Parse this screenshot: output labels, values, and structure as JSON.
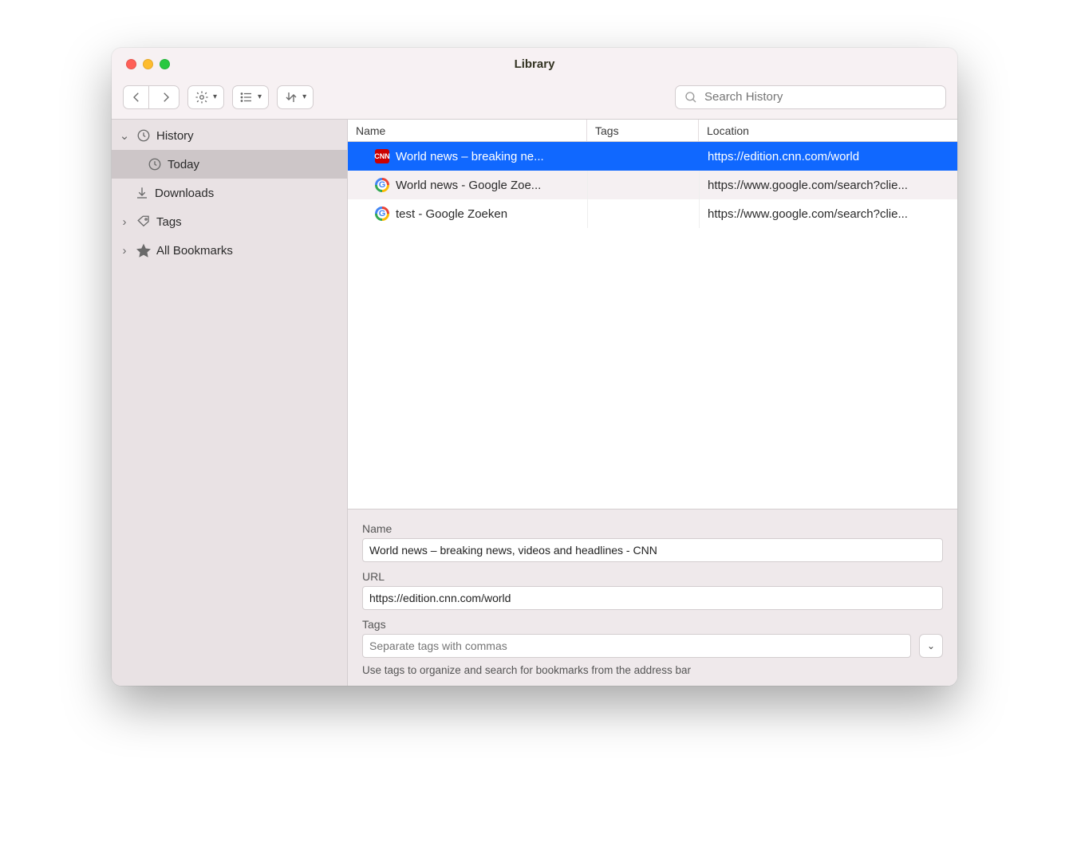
{
  "window": {
    "title": "Library"
  },
  "toolbar": {
    "search_placeholder": "Search History"
  },
  "sidebar": {
    "items": [
      {
        "label": "History",
        "icon": "clock",
        "expanded": true,
        "children": [
          {
            "label": "Today",
            "icon": "clock",
            "selected": true
          }
        ]
      },
      {
        "label": "Downloads",
        "icon": "download",
        "children_placeholder": false
      },
      {
        "label": "Tags",
        "icon": "tag",
        "expandable": true
      },
      {
        "label": "All Bookmarks",
        "icon": "star",
        "expandable": true
      }
    ]
  },
  "columns": {
    "name": "Name",
    "tags": "Tags",
    "location": "Location"
  },
  "rows": [
    {
      "name": "World news – breaking ne...",
      "tags": "",
      "location": "https://edition.cnn.com/world",
      "favicon": "cnn",
      "favicon_text": "CNN",
      "selected": true
    },
    {
      "name": "World news - Google Zoe...",
      "tags": "",
      "location": "https://www.google.com/search?clie...",
      "favicon": "google",
      "alt": true
    },
    {
      "name": "test - Google Zoeken",
      "tags": "",
      "location": "https://www.google.com/search?clie...",
      "favicon": "google"
    }
  ],
  "detail": {
    "name_label": "Name",
    "name_value": "World news – breaking news, videos and headlines - CNN",
    "url_label": "URL",
    "url_value": "https://edition.cnn.com/world",
    "tags_label": "Tags",
    "tags_placeholder": "Separate tags with commas",
    "hint": "Use tags to organize and search for bookmarks from the address bar"
  }
}
